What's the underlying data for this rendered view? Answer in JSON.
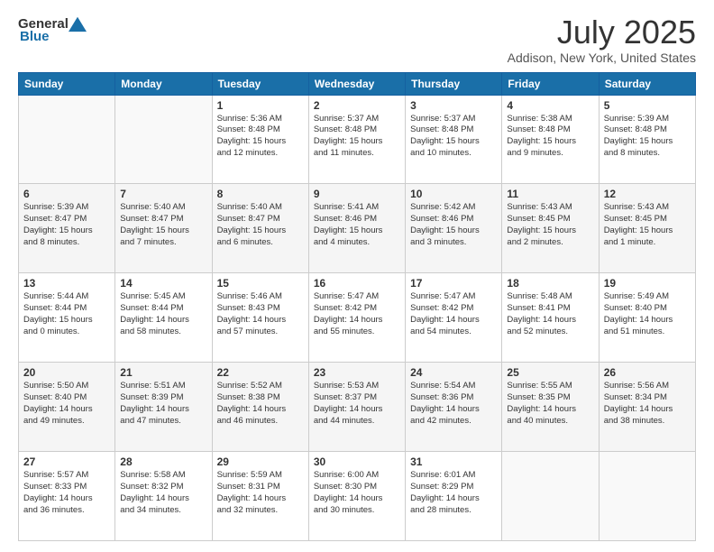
{
  "header": {
    "logo_general": "General",
    "logo_blue": "Blue",
    "title": "July 2025",
    "subtitle": "Addison, New York, United States"
  },
  "calendar": {
    "days_of_week": [
      "Sunday",
      "Monday",
      "Tuesday",
      "Wednesday",
      "Thursday",
      "Friday",
      "Saturday"
    ],
    "weeks": [
      [
        {
          "num": "",
          "info": ""
        },
        {
          "num": "",
          "info": ""
        },
        {
          "num": "1",
          "info": "Sunrise: 5:36 AM\nSunset: 8:48 PM\nDaylight: 15 hours\nand 12 minutes."
        },
        {
          "num": "2",
          "info": "Sunrise: 5:37 AM\nSunset: 8:48 PM\nDaylight: 15 hours\nand 11 minutes."
        },
        {
          "num": "3",
          "info": "Sunrise: 5:37 AM\nSunset: 8:48 PM\nDaylight: 15 hours\nand 10 minutes."
        },
        {
          "num": "4",
          "info": "Sunrise: 5:38 AM\nSunset: 8:48 PM\nDaylight: 15 hours\nand 9 minutes."
        },
        {
          "num": "5",
          "info": "Sunrise: 5:39 AM\nSunset: 8:48 PM\nDaylight: 15 hours\nand 8 minutes."
        }
      ],
      [
        {
          "num": "6",
          "info": "Sunrise: 5:39 AM\nSunset: 8:47 PM\nDaylight: 15 hours\nand 8 minutes."
        },
        {
          "num": "7",
          "info": "Sunrise: 5:40 AM\nSunset: 8:47 PM\nDaylight: 15 hours\nand 7 minutes."
        },
        {
          "num": "8",
          "info": "Sunrise: 5:40 AM\nSunset: 8:47 PM\nDaylight: 15 hours\nand 6 minutes."
        },
        {
          "num": "9",
          "info": "Sunrise: 5:41 AM\nSunset: 8:46 PM\nDaylight: 15 hours\nand 4 minutes."
        },
        {
          "num": "10",
          "info": "Sunrise: 5:42 AM\nSunset: 8:46 PM\nDaylight: 15 hours\nand 3 minutes."
        },
        {
          "num": "11",
          "info": "Sunrise: 5:43 AM\nSunset: 8:45 PM\nDaylight: 15 hours\nand 2 minutes."
        },
        {
          "num": "12",
          "info": "Sunrise: 5:43 AM\nSunset: 8:45 PM\nDaylight: 15 hours\nand 1 minute."
        }
      ],
      [
        {
          "num": "13",
          "info": "Sunrise: 5:44 AM\nSunset: 8:44 PM\nDaylight: 15 hours\nand 0 minutes."
        },
        {
          "num": "14",
          "info": "Sunrise: 5:45 AM\nSunset: 8:44 PM\nDaylight: 14 hours\nand 58 minutes."
        },
        {
          "num": "15",
          "info": "Sunrise: 5:46 AM\nSunset: 8:43 PM\nDaylight: 14 hours\nand 57 minutes."
        },
        {
          "num": "16",
          "info": "Sunrise: 5:47 AM\nSunset: 8:42 PM\nDaylight: 14 hours\nand 55 minutes."
        },
        {
          "num": "17",
          "info": "Sunrise: 5:47 AM\nSunset: 8:42 PM\nDaylight: 14 hours\nand 54 minutes."
        },
        {
          "num": "18",
          "info": "Sunrise: 5:48 AM\nSunset: 8:41 PM\nDaylight: 14 hours\nand 52 minutes."
        },
        {
          "num": "19",
          "info": "Sunrise: 5:49 AM\nSunset: 8:40 PM\nDaylight: 14 hours\nand 51 minutes."
        }
      ],
      [
        {
          "num": "20",
          "info": "Sunrise: 5:50 AM\nSunset: 8:40 PM\nDaylight: 14 hours\nand 49 minutes."
        },
        {
          "num": "21",
          "info": "Sunrise: 5:51 AM\nSunset: 8:39 PM\nDaylight: 14 hours\nand 47 minutes."
        },
        {
          "num": "22",
          "info": "Sunrise: 5:52 AM\nSunset: 8:38 PM\nDaylight: 14 hours\nand 46 minutes."
        },
        {
          "num": "23",
          "info": "Sunrise: 5:53 AM\nSunset: 8:37 PM\nDaylight: 14 hours\nand 44 minutes."
        },
        {
          "num": "24",
          "info": "Sunrise: 5:54 AM\nSunset: 8:36 PM\nDaylight: 14 hours\nand 42 minutes."
        },
        {
          "num": "25",
          "info": "Sunrise: 5:55 AM\nSunset: 8:35 PM\nDaylight: 14 hours\nand 40 minutes."
        },
        {
          "num": "26",
          "info": "Sunrise: 5:56 AM\nSunset: 8:34 PM\nDaylight: 14 hours\nand 38 minutes."
        }
      ],
      [
        {
          "num": "27",
          "info": "Sunrise: 5:57 AM\nSunset: 8:33 PM\nDaylight: 14 hours\nand 36 minutes."
        },
        {
          "num": "28",
          "info": "Sunrise: 5:58 AM\nSunset: 8:32 PM\nDaylight: 14 hours\nand 34 minutes."
        },
        {
          "num": "29",
          "info": "Sunrise: 5:59 AM\nSunset: 8:31 PM\nDaylight: 14 hours\nand 32 minutes."
        },
        {
          "num": "30",
          "info": "Sunrise: 6:00 AM\nSunset: 8:30 PM\nDaylight: 14 hours\nand 30 minutes."
        },
        {
          "num": "31",
          "info": "Sunrise: 6:01 AM\nSunset: 8:29 PM\nDaylight: 14 hours\nand 28 minutes."
        },
        {
          "num": "",
          "info": ""
        },
        {
          "num": "",
          "info": ""
        }
      ]
    ]
  }
}
